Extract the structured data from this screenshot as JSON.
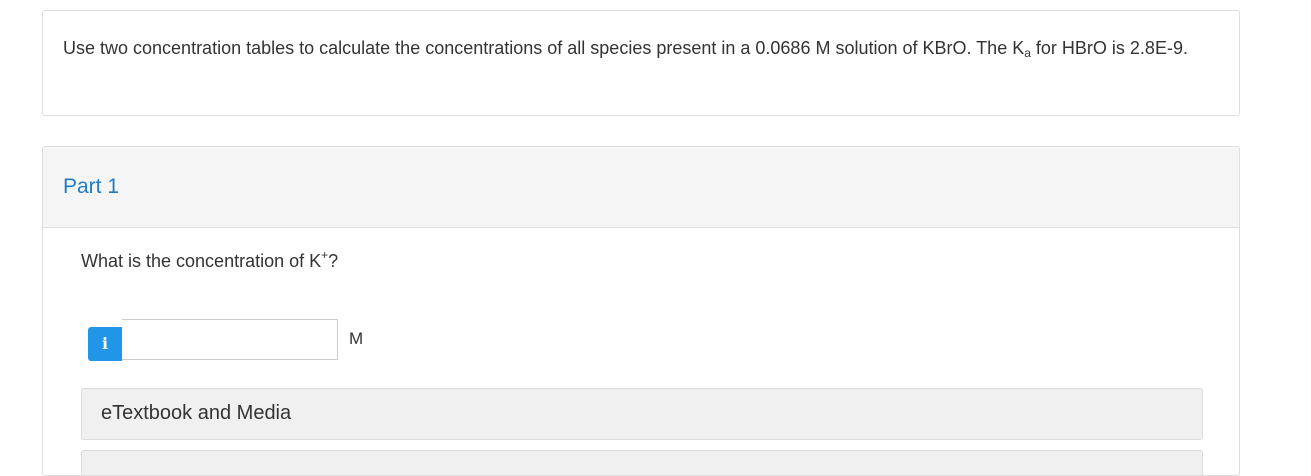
{
  "question": {
    "text_before_sub": "Use two concentration tables to calculate the concentrations of all species present in a 0.0686 M solution of KBrO. The K",
    "sub": "a",
    "text_after_sub": " for HBrO is 2.8E-9."
  },
  "part": {
    "title": "Part 1",
    "prompt_before_sup": "What is the concentration of K",
    "prompt_sup": "+",
    "prompt_after_sup": "?",
    "info_icon": "i",
    "input_value": "",
    "input_placeholder": "",
    "unit": "M",
    "etextbook_label": "eTextbook and Media"
  },
  "colors": {
    "part_title": "#1f7bc6",
    "info_button": "#2196e8"
  }
}
